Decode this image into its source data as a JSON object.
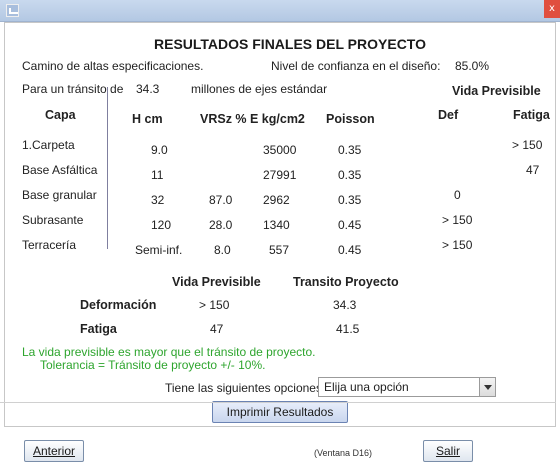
{
  "window": {
    "close_label": "x"
  },
  "title": "RESULTADOS FINALES DEL PROYECTO",
  "info": {
    "road_type": "Camino de altas especificaciones.",
    "confidence_label": "Nivel de confianza en el diseño:",
    "confidence_value": "85.0%",
    "transit_prefix": "Para un tránsito de",
    "transit_value": "34.3",
    "transit_suffix": "millones de ejes estándar",
    "vida_previsible_header": "Vida Previsible"
  },
  "table": {
    "headers": {
      "capa": "Capa",
      "h": "H cm",
      "vrs": "VRSz %",
      "e": "E kg/cm2",
      "poisson": "Poisson",
      "def": "Def",
      "fatiga": "Fatiga"
    },
    "rows": [
      {
        "capa": "1.Carpeta",
        "h": "9.0",
        "vrs": "",
        "e": "35000",
        "poisson": "0.35",
        "def": "",
        "fatiga": "> 150"
      },
      {
        "capa": "Base Asfáltica",
        "h": "11",
        "vrs": "",
        "e": "27991",
        "poisson": "0.35",
        "def": "",
        "fatiga": "47"
      },
      {
        "capa": "Base granular",
        "h": "32",
        "vrs": "87.0",
        "e": "2962",
        "poisson": "0.35",
        "def": "0",
        "fatiga": ""
      },
      {
        "capa": "Subrasante",
        "h": "120",
        "vrs": "28.0",
        "e": "1340",
        "poisson": "0.45",
        "def": "> 150",
        "fatiga": ""
      },
      {
        "capa": "Terracería",
        "h": "Semi-inf.",
        "vrs": "8.0",
        "e": "557",
        "poisson": "0.45",
        "def": "> 150",
        "fatiga": ""
      }
    ]
  },
  "summary": {
    "vida_header": "Vida Previsible",
    "transito_header": "Transito Proyecto",
    "deformacion_label": "Deformación",
    "deformacion_vida": "> 150",
    "deformacion_transito": "34.3",
    "fatiga_label": "Fatiga",
    "fatiga_vida": "47",
    "fatiga_transito": "41.5"
  },
  "message": {
    "line1": "La vida previsible es mayor que el tránsito de proyecto.",
    "line2": "Tolerancia = Tránsito de proyecto +/- 10%.",
    "color": "#2ea52e"
  },
  "options": {
    "label": "Tiene las siguientes opciones:",
    "selected": "Elija una opción"
  },
  "buttons": {
    "print": "Imprimir Resultados",
    "previous": "Anterior",
    "exit": "Salir"
  },
  "footer": {
    "window_id": "(Ventana D16)"
  }
}
